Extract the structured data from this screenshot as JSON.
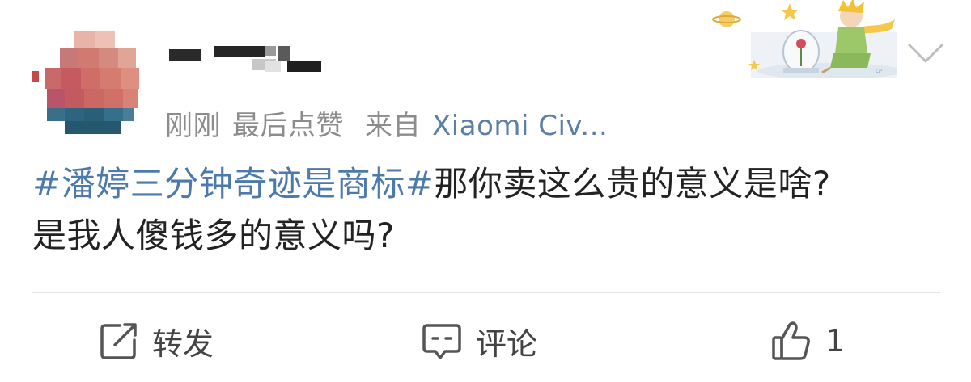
{
  "post": {
    "meta": {
      "time": "刚刚",
      "like_status": "最后点赞",
      "source_prefix": "来自",
      "source": "Xiaomi Civ..."
    },
    "content": {
      "topic": "#潘婷三分钟奇迹是商标#",
      "text_line1": "那你卖这么贵的意义是啥?",
      "text_line2": "是我人傻钱多的意义吗?"
    }
  },
  "actions": {
    "repost_label": "转发",
    "comment_label": "评论",
    "like_count": "1"
  },
  "icons": {
    "repost": "edit-share-icon",
    "comment": "comment-bubble-icon",
    "like": "thumbs-up-icon",
    "menu": "chevron-down-icon"
  },
  "colors": {
    "topic_link": "#4d7aad",
    "source_link": "#5b7fa6",
    "meta_text": "#8c8c8c",
    "body_text": "#222222"
  }
}
